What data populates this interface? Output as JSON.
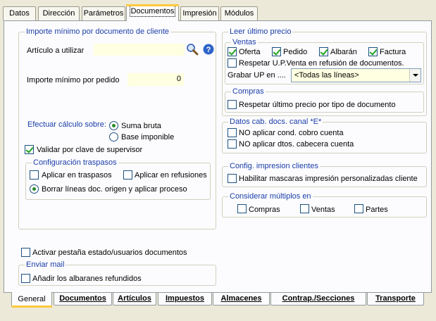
{
  "top_tabs": [
    "Datos",
    "Dirección",
    "Parámetros",
    "Documentos",
    "Impresión",
    "Módulos"
  ],
  "importe_group": {
    "title": "Importe mínimo por documento de cliente",
    "articulo_label": "Artículo a utilizar",
    "articulo_value": "",
    "importe_label": "Importe mínimo por pedido",
    "importe_value": "0",
    "calculo_label": "Efectuar cálculo sobre:",
    "suma_bruta": "Suma bruta",
    "base_imponible": "Base imponible",
    "validar": "Validar por clave de supervisor"
  },
  "traspasos_group": {
    "title": "Configuración traspasos",
    "aplicar_traspasos": "Aplicar en traspasos",
    "aplicar_refusiones": "Aplicar en refusiones",
    "borrar_lineas": "Borrar líneas doc. origen y aplicar proceso"
  },
  "leer_precio": {
    "title": "Leer último precio",
    "ventas_title": "Ventas",
    "oferta": "Oferta",
    "pedido": "Pedido",
    "albaran": "Albarán",
    "factura": "Factura",
    "respetar_up": "Respetar U.P.Venta en refusión de documentos.",
    "grabar_label": "Grabar UP en ....",
    "grabar_value": "<Todas las líneas>"
  },
  "compras_group": {
    "title": "Compras",
    "respetar": "Respetar último precio por tipo de documento"
  },
  "datos_cab": {
    "title": "Datos cab. docs. canal *E*",
    "no_cobro": "NO aplicar cond. cobro cuenta",
    "no_dtos": "NO aplicar dtos. cabecera cuenta"
  },
  "config_impresion": {
    "title": "Config. impresion clientes",
    "habilitar": "Habilitar mascaras impresión  personalizadas cliente"
  },
  "multiplos": {
    "title": "Considerar múltiplos en",
    "compras": "Compras",
    "ventas": "Ventas",
    "partes": "Partes"
  },
  "activar_pestana": "Activar pestaña estado/usuarios documentos",
  "enviar_mail": {
    "title": "Enviar mail",
    "anadir": "Añadir los albaranes refundidos"
  },
  "bottom_tabs": [
    "General",
    "Documentos",
    "Artículos",
    "Impuestos",
    "Almacenes",
    "Contrap./Secciones",
    "Transporte"
  ],
  "colors": {
    "group_title": "#1a3da8",
    "field_bg": "#ffffe1",
    "tab_highlight": "#ffc83c"
  }
}
